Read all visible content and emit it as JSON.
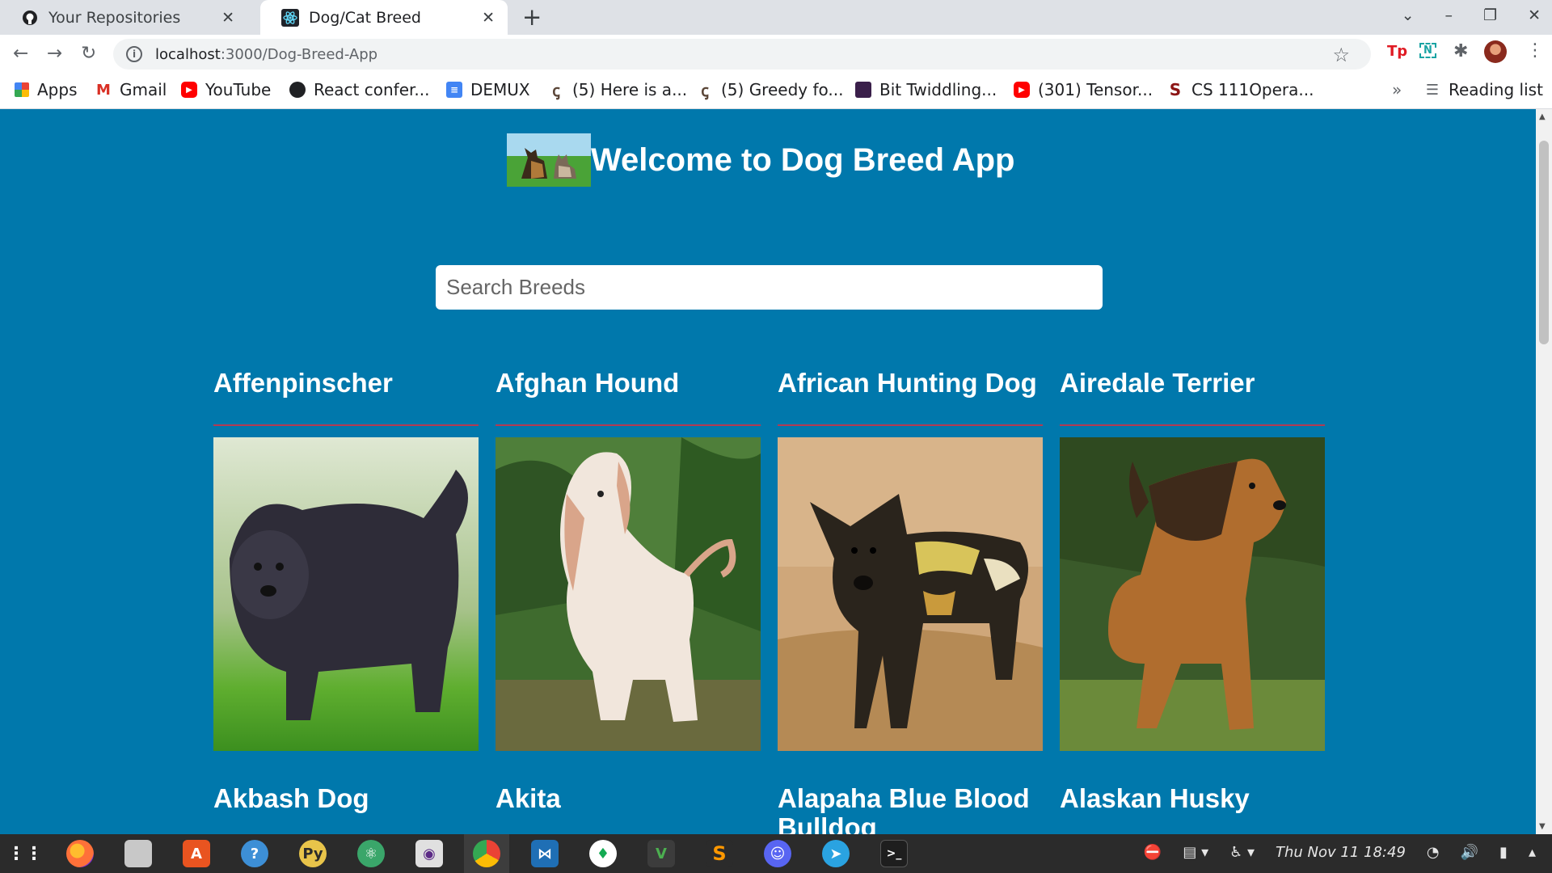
{
  "browser": {
    "tabs": [
      {
        "title": "Your Repositories",
        "icon": "github-icon",
        "active": false
      },
      {
        "title": "Dog/Cat Breed",
        "icon": "react-icon",
        "active": true
      }
    ],
    "new_tab_label": "+",
    "url_host": "localhost",
    "url_path": ":3000/Dog-Breed-App",
    "bookmarks": [
      {
        "label": "Apps",
        "icon": "apps-grid-icon"
      },
      {
        "label": "Gmail",
        "icon": "gmail-icon"
      },
      {
        "label": "YouTube",
        "icon": "youtube-icon"
      },
      {
        "label": "React confer...",
        "icon": "github-icon"
      },
      {
        "label": "DEMUX",
        "icon": "docs-icon"
      },
      {
        "label": "(5) Here is a...",
        "icon": "codechef-icon"
      },
      {
        "label": "(5) Greedy fo...",
        "icon": "codechef-icon"
      },
      {
        "label": "Bit Twiddling...",
        "icon": "bookmark-page-icon"
      },
      {
        "label": "(301) Tensor...",
        "icon": "youtube-icon"
      },
      {
        "label": "CS 111Opera...",
        "icon": "stanford-icon"
      }
    ],
    "overflow_label": "»",
    "reading_list_label": "Reading list"
  },
  "app": {
    "title": "Welcome to Dog Breed App",
    "search_placeholder": "Search Breeds",
    "breeds": [
      {
        "name": "Affenpinscher"
      },
      {
        "name": "Afghan Hound"
      },
      {
        "name": "African Hunting Dog"
      },
      {
        "name": "Airedale Terrier"
      },
      {
        "name": "Akbash Dog"
      },
      {
        "name": "Akita"
      },
      {
        "name": "Alapaha Blue Blood Bulldog"
      },
      {
        "name": "Alaskan Husky"
      }
    ]
  },
  "taskbar": {
    "apps": [
      "app-grid-icon",
      "firefox-icon",
      "files-icon",
      "software-center-icon",
      "help-icon",
      "python-icon",
      "atom-icon",
      "screenshot-icon",
      "chrome-icon",
      "vscode-icon",
      "mongodb-icon",
      "vim-icon",
      "sublime-icon",
      "discord-icon",
      "telegram-icon",
      "terminal-icon"
    ],
    "clock": "Thu Nov 11  18:49"
  },
  "colors": {
    "page_background": "#0078ac",
    "card_rule": "#b23a52",
    "heading_text": "#ffffff"
  }
}
